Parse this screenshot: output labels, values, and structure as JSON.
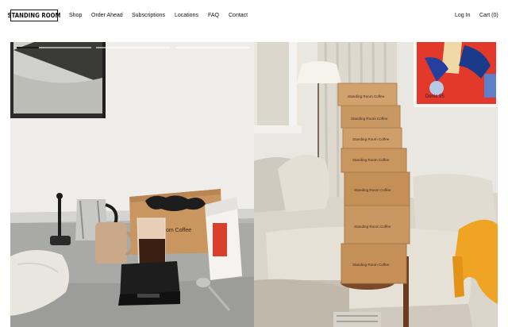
{
  "header": {
    "logo_text": "STANDING ROOM",
    "nav": [
      "Shop",
      "Order Ahead",
      "Subscriptions",
      "Locations",
      "FAQ",
      "Contact"
    ],
    "login_label": "Log In",
    "cart_label": "Cart (0)"
  },
  "hero": {
    "left_box_text": "om Coffee",
    "stack_box_text": "Standing Room Coffee",
    "poster_text": "Denis 95",
    "slides": [
      {
        "progress": 0.3
      },
      {
        "progress": 0
      },
      {
        "progress": 0
      }
    ]
  },
  "colors": {
    "text": "#111111",
    "kraft_box": "#c9965f",
    "bag_red": "#d8402c",
    "poster_red": "#e2392b",
    "blanket_orange": "#f0a424"
  }
}
